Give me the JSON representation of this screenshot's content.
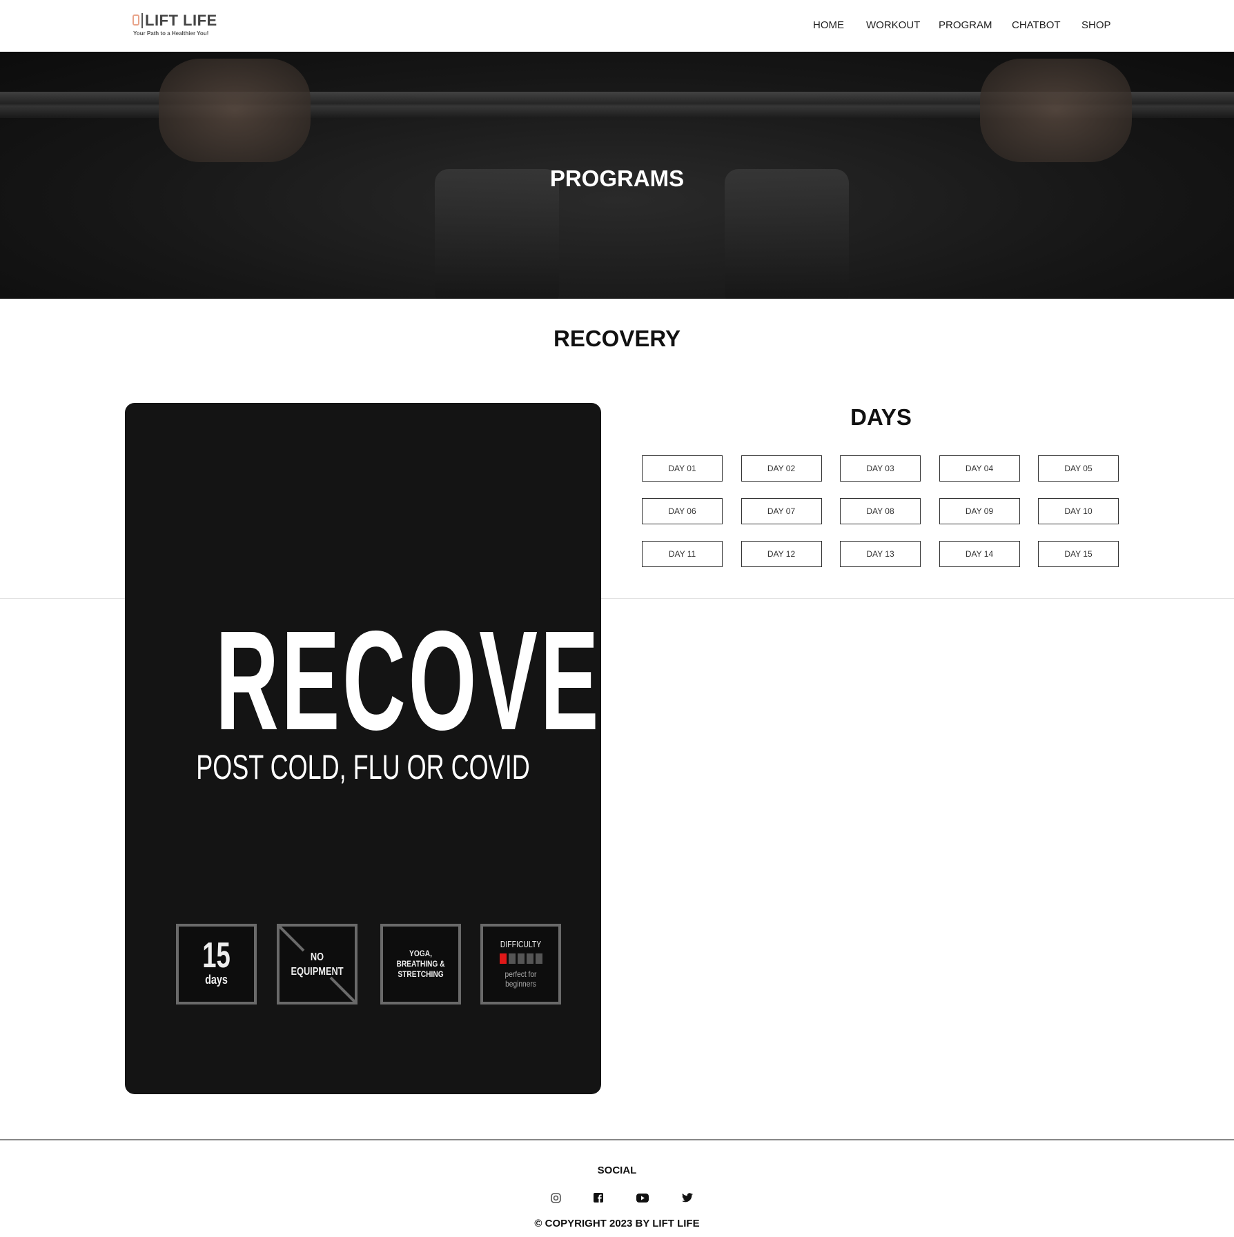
{
  "brand": {
    "name": "LIFT LIFE",
    "tagline": "Your Path to a Healthier You!"
  },
  "nav": [
    "HOME",
    "WORKOUT",
    "PROGRAM",
    "CHATBOT",
    "SHOP"
  ],
  "hero": {
    "title": "PROGRAMS"
  },
  "program": {
    "title": "RECOVERY",
    "card": {
      "headline": "RECOVERY",
      "subtitle": "POST COLD, FLU OR COVID",
      "duration_number": "15",
      "duration_unit": "days",
      "equipment": "NO EQUIPMENT",
      "type": "YOGA, BREATHING & STRETCHING",
      "difficulty_label": "DIFFICULTY",
      "difficulty_level": 1,
      "difficulty_max": 5,
      "difficulty_note": "perfect for beginners"
    },
    "days_heading": "DAYS",
    "days": [
      "DAY 01",
      "DAY 02",
      "DAY 03",
      "DAY 04",
      "DAY 05",
      "DAY 06",
      "DAY 07",
      "DAY 08",
      "DAY 09",
      "DAY 10",
      "DAY 11",
      "DAY 12",
      "DAY 13",
      "DAY 14",
      "DAY 15"
    ]
  },
  "footer": {
    "social_heading": "SOCIAL",
    "icons": [
      "instagram-icon",
      "facebook-icon",
      "youtube-icon",
      "twitter-icon"
    ],
    "copyright": "© COPYRIGHT 2023 BY LIFT LIFE"
  },
  "colors": {
    "accent": "#e01818",
    "card_bg": "#141414"
  }
}
